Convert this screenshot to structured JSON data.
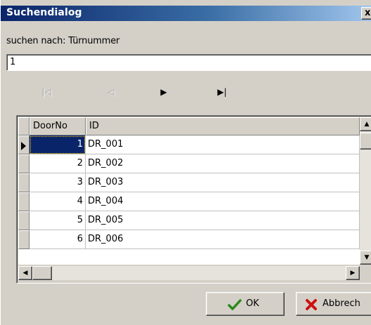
{
  "dialog": {
    "title": "Suchendialog",
    "close_label": "x",
    "search_label": "suchen nach: Türnummer",
    "search_value": "1"
  },
  "navigator": {
    "buttons": [
      {
        "name": "first",
        "glyph": "|◁",
        "enabled": false
      },
      {
        "name": "prior",
        "glyph": "◁",
        "enabled": false
      },
      {
        "name": "next",
        "glyph": "▶",
        "enabled": true
      },
      {
        "name": "last",
        "glyph": "▶|",
        "enabled": true
      }
    ]
  },
  "grid": {
    "columns": [
      "DoorNo",
      "ID"
    ],
    "rows": [
      {
        "door_no": "1",
        "id": "DR_001"
      },
      {
        "door_no": "2",
        "id": "DR_002"
      },
      {
        "door_no": "3",
        "id": "DR_003"
      },
      {
        "door_no": "4",
        "id": "DR_004"
      },
      {
        "door_no": "5",
        "id": "DR_005"
      },
      {
        "door_no": "6",
        "id": "DR_006"
      }
    ],
    "selected_row": 0
  },
  "buttons": {
    "ok_label": "OK",
    "cancel_label": "Abbrech"
  },
  "colors": {
    "title_bar": "#0a246a",
    "selection": "#0a246a",
    "ok_icon": "#2a8a1a",
    "cancel_icon": "#cc1111"
  }
}
